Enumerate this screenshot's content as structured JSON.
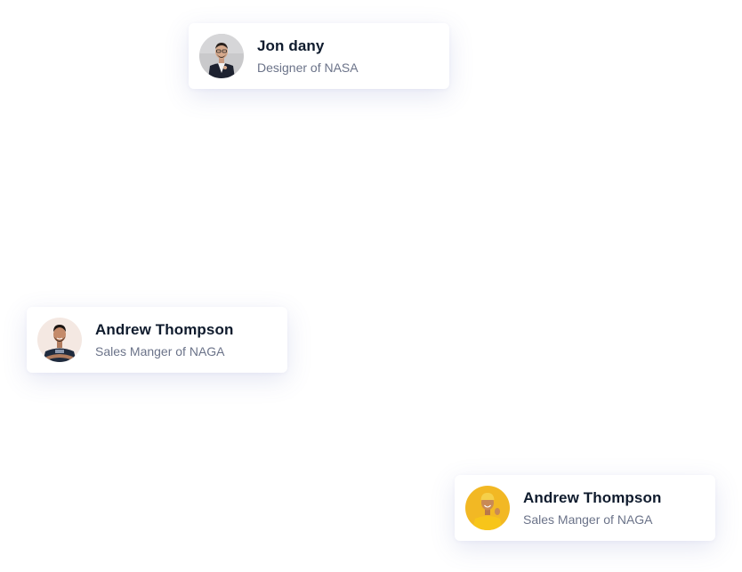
{
  "cards": [
    {
      "name": "Jon dany",
      "role": "Designer of NASA",
      "avatar_icon": "man-in-suit-photo"
    },
    {
      "name": "Andrew Thompson",
      "role": "Sales Manger of NAGA",
      "avatar_icon": "man-dark-tshirt-photo"
    },
    {
      "name": "Andrew Thompson",
      "role": "Sales Manger of NAGA",
      "avatar_icon": "man-yellow-background-photo"
    }
  ],
  "colors": {
    "name_text": "#0f1b2d",
    "role_text": "#6b7389",
    "card_bg": "#ffffff"
  }
}
